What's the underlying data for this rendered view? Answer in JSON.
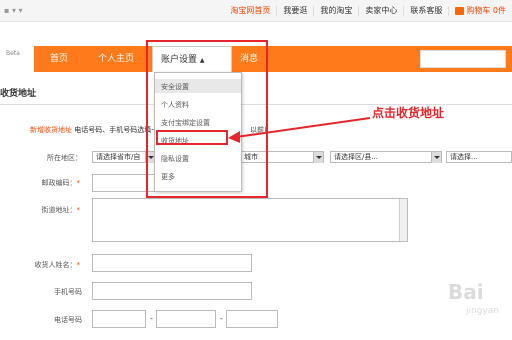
{
  "topbar": {
    "left_text": "▪ ▾ ▾",
    "links": [
      "淘宝网首页",
      "我要逛",
      "我的淘宝",
      "卖家中心",
      "联系客服"
    ],
    "cart": "购物车 0件"
  },
  "nav": {
    "beta": "Beta",
    "items": [
      "首页",
      "个人主页",
      "账户设置",
      "消息"
    ]
  },
  "dropdown": {
    "items": [
      "安全设置",
      "个人资料",
      "支付宝绑定设置",
      "收货地址",
      "隐私设置",
      "更多"
    ]
  },
  "page": {
    "section_title": "收货地址",
    "new_address_label": "新增收货地址",
    "hint": "电话号码、手机号码选填一项，其余均为必填项",
    "hint_tail": "以前)"
  },
  "form": {
    "region_label": "所在地区：",
    "province_select": "请选择省市/自",
    "city_select": "城市",
    "district_select": "请选择区/县...",
    "street_select": "请选择...",
    "postal_label": "邮政编码：",
    "street_label": "街道地址：",
    "name_label": "收货人姓名：",
    "mobile_label": "手机号码",
    "phone_label": "电话号码",
    "dash": "-"
  },
  "annotation": "点击收货地址",
  "colors": {
    "nav_orange": "#ff7a1a",
    "accent_red": "#e5262d",
    "link_orange": "#ff4400"
  },
  "watermark": {
    "main": "Bai",
    "sub": "jingyan"
  }
}
